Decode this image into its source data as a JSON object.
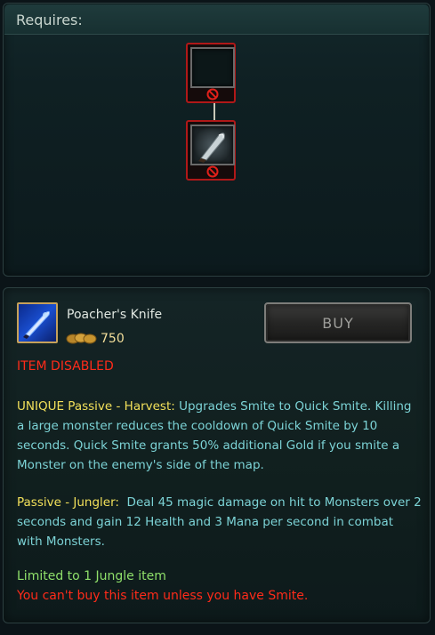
{
  "requires": {
    "title": "Requires:"
  },
  "item": {
    "name": "Poacher's Knife",
    "price": "750",
    "buy_label": "BUY",
    "status": "ITEM DISABLED",
    "passive_1": {
      "prefix": "UNIQUE Passive - Harvest:",
      "text": " Upgrades Smite to Quick Smite. Killing a large monster reduces the cooldown of Quick Smite by 10 seconds. Quick Smite grants 50% additional Gold if you smite a Monster on the enemy's side of the map."
    },
    "passive_2": {
      "prefix": "Passive - Jungler:",
      "text": "  Deal 45 magic damage on hit to Monsters over 2 seconds and gain 12 Health and 3 Mana per second in combat with Monsters."
    },
    "limit": "Limited to 1 Jungle item",
    "warning": "You can't buy this item unless you have Smite."
  },
  "icons": {
    "blocked": "blocked-icon",
    "coins": "gold-coins-icon",
    "item": "poachers-knife-icon",
    "requirement": "knife-icon"
  },
  "colors": {
    "disabled_red": "#ff2b1a",
    "passive_gold": "#f2e05a",
    "description_cyan": "#7cd3d6",
    "limit_green": "#8fe06a",
    "price_gold": "#f4df9b"
  }
}
